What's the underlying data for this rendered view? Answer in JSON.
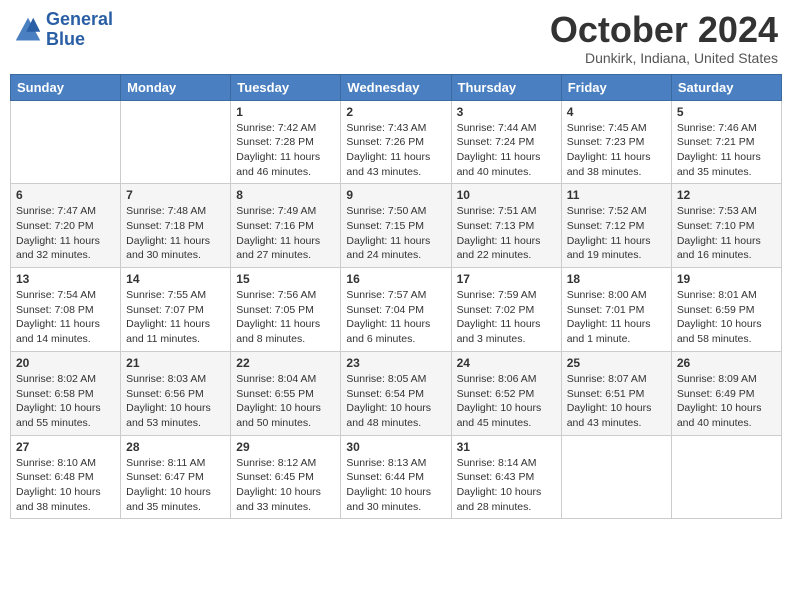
{
  "logo": {
    "line1": "General",
    "line2": "Blue"
  },
  "title": "October 2024",
  "subtitle": "Dunkirk, Indiana, United States",
  "days_header": [
    "Sunday",
    "Monday",
    "Tuesday",
    "Wednesday",
    "Thursday",
    "Friday",
    "Saturday"
  ],
  "weeks": [
    [
      {
        "day": "",
        "sunrise": "",
        "sunset": "",
        "daylight": ""
      },
      {
        "day": "",
        "sunrise": "",
        "sunset": "",
        "daylight": ""
      },
      {
        "day": "1",
        "sunrise": "Sunrise: 7:42 AM",
        "sunset": "Sunset: 7:28 PM",
        "daylight": "Daylight: 11 hours and 46 minutes."
      },
      {
        "day": "2",
        "sunrise": "Sunrise: 7:43 AM",
        "sunset": "Sunset: 7:26 PM",
        "daylight": "Daylight: 11 hours and 43 minutes."
      },
      {
        "day": "3",
        "sunrise": "Sunrise: 7:44 AM",
        "sunset": "Sunset: 7:24 PM",
        "daylight": "Daylight: 11 hours and 40 minutes."
      },
      {
        "day": "4",
        "sunrise": "Sunrise: 7:45 AM",
        "sunset": "Sunset: 7:23 PM",
        "daylight": "Daylight: 11 hours and 38 minutes."
      },
      {
        "day": "5",
        "sunrise": "Sunrise: 7:46 AM",
        "sunset": "Sunset: 7:21 PM",
        "daylight": "Daylight: 11 hours and 35 minutes."
      }
    ],
    [
      {
        "day": "6",
        "sunrise": "Sunrise: 7:47 AM",
        "sunset": "Sunset: 7:20 PM",
        "daylight": "Daylight: 11 hours and 32 minutes."
      },
      {
        "day": "7",
        "sunrise": "Sunrise: 7:48 AM",
        "sunset": "Sunset: 7:18 PM",
        "daylight": "Daylight: 11 hours and 30 minutes."
      },
      {
        "day": "8",
        "sunrise": "Sunrise: 7:49 AM",
        "sunset": "Sunset: 7:16 PM",
        "daylight": "Daylight: 11 hours and 27 minutes."
      },
      {
        "day": "9",
        "sunrise": "Sunrise: 7:50 AM",
        "sunset": "Sunset: 7:15 PM",
        "daylight": "Daylight: 11 hours and 24 minutes."
      },
      {
        "day": "10",
        "sunrise": "Sunrise: 7:51 AM",
        "sunset": "Sunset: 7:13 PM",
        "daylight": "Daylight: 11 hours and 22 minutes."
      },
      {
        "day": "11",
        "sunrise": "Sunrise: 7:52 AM",
        "sunset": "Sunset: 7:12 PM",
        "daylight": "Daylight: 11 hours and 19 minutes."
      },
      {
        "day": "12",
        "sunrise": "Sunrise: 7:53 AM",
        "sunset": "Sunset: 7:10 PM",
        "daylight": "Daylight: 11 hours and 16 minutes."
      }
    ],
    [
      {
        "day": "13",
        "sunrise": "Sunrise: 7:54 AM",
        "sunset": "Sunset: 7:08 PM",
        "daylight": "Daylight: 11 hours and 14 minutes."
      },
      {
        "day": "14",
        "sunrise": "Sunrise: 7:55 AM",
        "sunset": "Sunset: 7:07 PM",
        "daylight": "Daylight: 11 hours and 11 minutes."
      },
      {
        "day": "15",
        "sunrise": "Sunrise: 7:56 AM",
        "sunset": "Sunset: 7:05 PM",
        "daylight": "Daylight: 11 hours and 8 minutes."
      },
      {
        "day": "16",
        "sunrise": "Sunrise: 7:57 AM",
        "sunset": "Sunset: 7:04 PM",
        "daylight": "Daylight: 11 hours and 6 minutes."
      },
      {
        "day": "17",
        "sunrise": "Sunrise: 7:59 AM",
        "sunset": "Sunset: 7:02 PM",
        "daylight": "Daylight: 11 hours and 3 minutes."
      },
      {
        "day": "18",
        "sunrise": "Sunrise: 8:00 AM",
        "sunset": "Sunset: 7:01 PM",
        "daylight": "Daylight: 11 hours and 1 minute."
      },
      {
        "day": "19",
        "sunrise": "Sunrise: 8:01 AM",
        "sunset": "Sunset: 6:59 PM",
        "daylight": "Daylight: 10 hours and 58 minutes."
      }
    ],
    [
      {
        "day": "20",
        "sunrise": "Sunrise: 8:02 AM",
        "sunset": "Sunset: 6:58 PM",
        "daylight": "Daylight: 10 hours and 55 minutes."
      },
      {
        "day": "21",
        "sunrise": "Sunrise: 8:03 AM",
        "sunset": "Sunset: 6:56 PM",
        "daylight": "Daylight: 10 hours and 53 minutes."
      },
      {
        "day": "22",
        "sunrise": "Sunrise: 8:04 AM",
        "sunset": "Sunset: 6:55 PM",
        "daylight": "Daylight: 10 hours and 50 minutes."
      },
      {
        "day": "23",
        "sunrise": "Sunrise: 8:05 AM",
        "sunset": "Sunset: 6:54 PM",
        "daylight": "Daylight: 10 hours and 48 minutes."
      },
      {
        "day": "24",
        "sunrise": "Sunrise: 8:06 AM",
        "sunset": "Sunset: 6:52 PM",
        "daylight": "Daylight: 10 hours and 45 minutes."
      },
      {
        "day": "25",
        "sunrise": "Sunrise: 8:07 AM",
        "sunset": "Sunset: 6:51 PM",
        "daylight": "Daylight: 10 hours and 43 minutes."
      },
      {
        "day": "26",
        "sunrise": "Sunrise: 8:09 AM",
        "sunset": "Sunset: 6:49 PM",
        "daylight": "Daylight: 10 hours and 40 minutes."
      }
    ],
    [
      {
        "day": "27",
        "sunrise": "Sunrise: 8:10 AM",
        "sunset": "Sunset: 6:48 PM",
        "daylight": "Daylight: 10 hours and 38 minutes."
      },
      {
        "day": "28",
        "sunrise": "Sunrise: 8:11 AM",
        "sunset": "Sunset: 6:47 PM",
        "daylight": "Daylight: 10 hours and 35 minutes."
      },
      {
        "day": "29",
        "sunrise": "Sunrise: 8:12 AM",
        "sunset": "Sunset: 6:45 PM",
        "daylight": "Daylight: 10 hours and 33 minutes."
      },
      {
        "day": "30",
        "sunrise": "Sunrise: 8:13 AM",
        "sunset": "Sunset: 6:44 PM",
        "daylight": "Daylight: 10 hours and 30 minutes."
      },
      {
        "day": "31",
        "sunrise": "Sunrise: 8:14 AM",
        "sunset": "Sunset: 6:43 PM",
        "daylight": "Daylight: 10 hours and 28 minutes."
      },
      {
        "day": "",
        "sunrise": "",
        "sunset": "",
        "daylight": ""
      },
      {
        "day": "",
        "sunrise": "",
        "sunset": "",
        "daylight": ""
      }
    ]
  ]
}
